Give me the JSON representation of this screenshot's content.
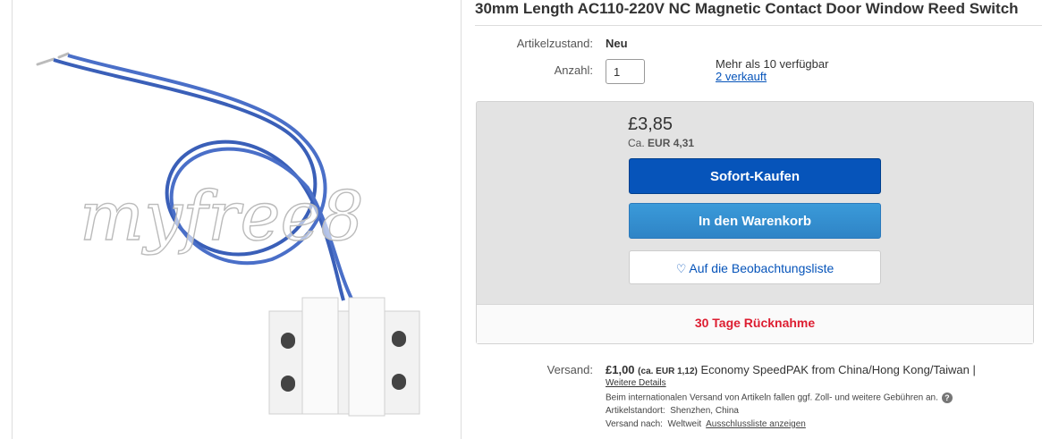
{
  "product": {
    "title": "30mm Length AC110-220V NC Magnetic Contact Door Window Reed Switch",
    "image_alt": "White magnetic reed switch with blue wires",
    "watermark": "myfree8"
  },
  "details": {
    "condition_label": "Artikelzustand:",
    "condition_value": "Neu",
    "quantity_label": "Anzahl:",
    "quantity_value": "1",
    "availability": "Mehr als 10 verfügbar",
    "sold_link": "2 verkauft"
  },
  "buy_box": {
    "price": "£3,85",
    "converted_prefix": "Ca.",
    "converted_price": "EUR 4,31",
    "buy_now_label": "Sofort-Kaufen",
    "add_to_cart_label": "In den Warenkorb",
    "watchlist_label": "Auf die Beobachtungsliste",
    "returns_label": "30 Tage Rücknahme"
  },
  "shipping": {
    "label": "Versand:",
    "price": "£1,00",
    "converted": "(ca. EUR 1,12)",
    "service": "Economy SpeedPAK from China/Hong Kong/Taiwan |",
    "details_link": "Weitere Details",
    "intl_note": "Beim internationalen Versand von Artikeln fallen ggf. Zoll- und weitere Gebühren an.",
    "location_label": "Artikelstandort:",
    "location_value": "Shenzhen, China",
    "ships_to_label": "Versand nach:",
    "ships_to_value": "Weltweit",
    "exclusion_link": "Ausschlussliste anzeigen"
  },
  "colors": {
    "buy_button": "#0654ba",
    "cart_button": "#3a9ad9",
    "returns_text": "#dd1e31",
    "link": "#0654ba"
  },
  "icons": {
    "watchlist": "heart-icon",
    "help": "question-circle-icon"
  }
}
